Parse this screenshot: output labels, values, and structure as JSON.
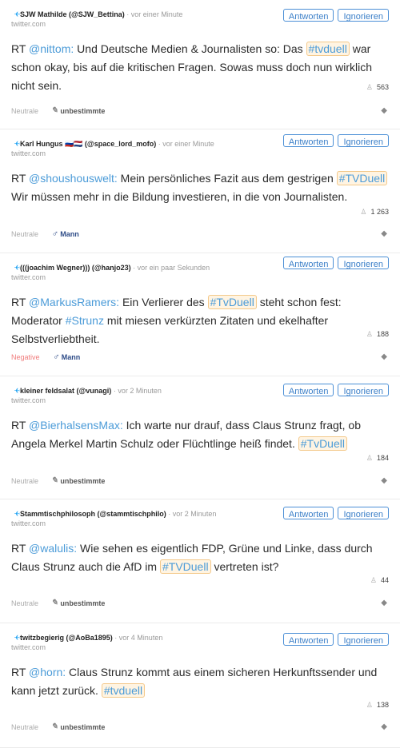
{
  "buttons": {
    "reply": "Antworten",
    "ignore": "Ignorieren"
  },
  "source_label": "twitter.com",
  "sep": "·",
  "posts": [
    {
      "author": "SJW Mathilde (@SJW_Bettina)",
      "time": "vor einer Minute",
      "parts": [
        {
          "t": "RT "
        },
        {
          "t": "@nittom:",
          "k": "mention"
        },
        {
          "t": " Und Deutsche Medien & Journalisten so: Das "
        },
        {
          "t": "#tvduell",
          "k": "hashtag"
        },
        {
          "t": " war schon okay, bis auf die kritischen Fragen. Sowas muss doch nun wirklich nicht sein."
        }
      ],
      "count": "563",
      "sentiment": "Neutrale",
      "gender": "unbestimmte"
    },
    {
      "author": "Karl Hungus 🇷🇺🇳🇱 (@space_lord_mofo)",
      "time": "vor einer Minute",
      "parts": [
        {
          "t": "RT "
        },
        {
          "t": "@shoushouswelt:",
          "k": "mention"
        },
        {
          "t": " Mein persönliches Fazit aus dem gestrigen "
        },
        {
          "t": "#TVDuell",
          "k": "hashtag"
        },
        {
          "t": " Wir müssen mehr in die Bildung investieren, in die von Journalisten."
        }
      ],
      "count": "1 263",
      "sentiment": "Neutrale",
      "gender": "Mann"
    },
    {
      "author": "(((joachim Wegner))) (@hanjo23)",
      "time": "vor ein paar Sekunden",
      "parts": [
        {
          "t": "RT "
        },
        {
          "t": "@MarkusRamers:",
          "k": "mention"
        },
        {
          "t": " Ein Verlierer des "
        },
        {
          "t": "#TvDuell",
          "k": "hashtag"
        },
        {
          "t": " steht schon fest: Moderator "
        },
        {
          "t": "#Strunz",
          "k": "mention"
        },
        {
          "t": " mit miesen verkürzten Zitaten und ekelhafter Selbstverliebtheit."
        }
      ],
      "count": "188",
      "sentiment": "Negative",
      "gender": "Mann"
    },
    {
      "author": "kleiner feldsalat (@vunagi)",
      "time": "vor 2 Minuten",
      "parts": [
        {
          "t": "RT "
        },
        {
          "t": "@BierhalsensMax:",
          "k": "mention"
        },
        {
          "t": " Ich warte nur drauf, dass Claus Strunz fragt, ob Angela Merkel Martin Schulz oder Flüchtlinge heiß findet. "
        },
        {
          "t": "#TvDuell",
          "k": "hashtag"
        }
      ],
      "count": "184",
      "sentiment": "Neutrale",
      "gender": "unbestimmte"
    },
    {
      "author": "Stammtischphilosoph (@stammtischphilo)",
      "time": "vor 2 Minuten",
      "parts": [
        {
          "t": "RT "
        },
        {
          "t": "@walulis:",
          "k": "mention"
        },
        {
          "t": " Wie sehen es eigentlich FDP, Grüne und Linke, dass durch Claus Strunz auch die AfD im "
        },
        {
          "t": "#TVDuell",
          "k": "hashtag"
        },
        {
          "t": " vertreten ist?"
        }
      ],
      "count": "44",
      "sentiment": "Neutrale",
      "gender": "unbestimmte"
    },
    {
      "author": "twitzbegierig (@AoBa1895)",
      "time": "vor 4 Minuten",
      "parts": [
        {
          "t": "RT "
        },
        {
          "t": "@horn:",
          "k": "mention"
        },
        {
          "t": " Claus Strunz kommt aus einem sicheren Herkunftssender und kann jetzt zurück. "
        },
        {
          "t": "#tvduell",
          "k": "hashtag"
        }
      ],
      "count": "138",
      "sentiment": "Neutrale",
      "gender": "unbestimmte"
    }
  ],
  "colors": {
    "accent": "#4b9bd8",
    "button_border": "#4b8fd6",
    "negative": "#f07b7b",
    "male": "#2c4a86",
    "hashtag_bg": "#fff4e2",
    "hashtag_border": "#f3c98b",
    "twitter": "#1da1f2"
  },
  "icons": {
    "twitter": "twitter-icon",
    "user": "user-icon",
    "tag": "tag-icon",
    "male": "male-icon",
    "undetermined": "pencil-icon"
  }
}
